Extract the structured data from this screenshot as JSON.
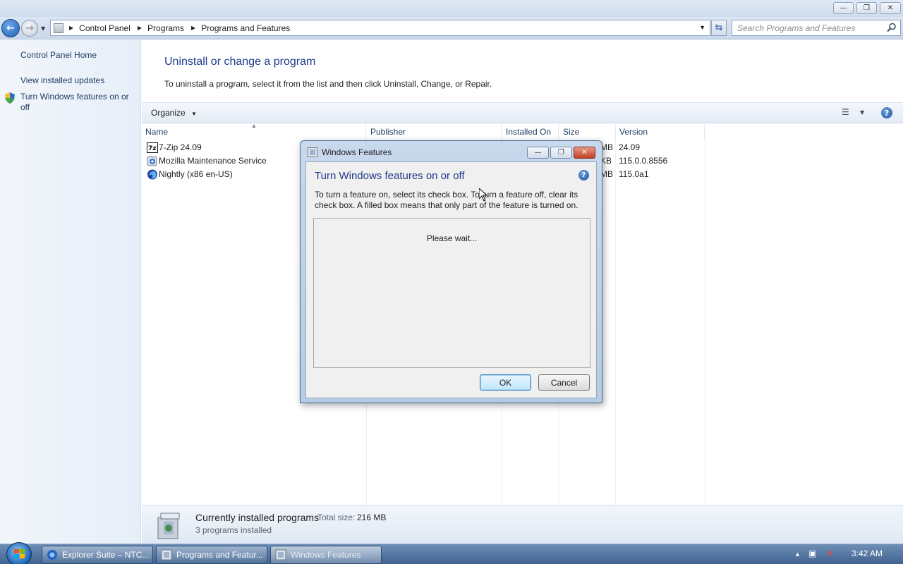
{
  "window": {
    "minimize_label": "—",
    "restore_label": "❐",
    "close_label": "✕"
  },
  "addressbar": {
    "breadcrumbs": [
      "Control Panel",
      "Programs",
      "Programs and Features"
    ],
    "search_placeholder": "Search Programs and Features"
  },
  "sidebar": {
    "items": [
      {
        "label": "Control Panel Home"
      },
      {
        "label": "View installed updates"
      },
      {
        "label": "Turn Windows features on or off"
      }
    ]
  },
  "main": {
    "title": "Uninstall or change a program",
    "description": "To uninstall a program, select it from the list and then click Uninstall, Change, or Repair.",
    "toolbar": {
      "organize_label": "Organize"
    },
    "columns": [
      "Name",
      "Publisher",
      "Installed On",
      "Size",
      "Version"
    ],
    "programs": [
      {
        "name": "7-Zip 24.09",
        "size_fragment": "MB",
        "version": "24.09"
      },
      {
        "name": "Mozilla Maintenance Service",
        "size_fragment": "KB",
        "version": "115.0.0.8556"
      },
      {
        "name": "Nightly (x86 en-US)",
        "size_fragment": "MB",
        "version": "115.0a1"
      }
    ]
  },
  "status": {
    "title": "Currently installed programs",
    "total_label": "Total size:",
    "total_value": "216 MB",
    "count_text": "3 programs installed"
  },
  "dialog": {
    "window_title": "Windows Features",
    "heading": "Turn Windows features on or off",
    "instructions": "To turn a feature on, select its check box. To turn a feature off, clear its check box. A filled box means that only part of the feature is turned on.",
    "wait_text": "Please wait...",
    "ok_label": "OK",
    "cancel_label": "Cancel"
  },
  "taskbar": {
    "items": [
      {
        "label": "Explorer Suite – NTC..."
      },
      {
        "label": "Programs and Featur..."
      },
      {
        "label": "Windows Features"
      }
    ],
    "clock": "3:42 AM"
  },
  "colors": {
    "link": "#1e3a5f",
    "heading": "#1e3a8a",
    "taskbar": "#3f6290"
  }
}
